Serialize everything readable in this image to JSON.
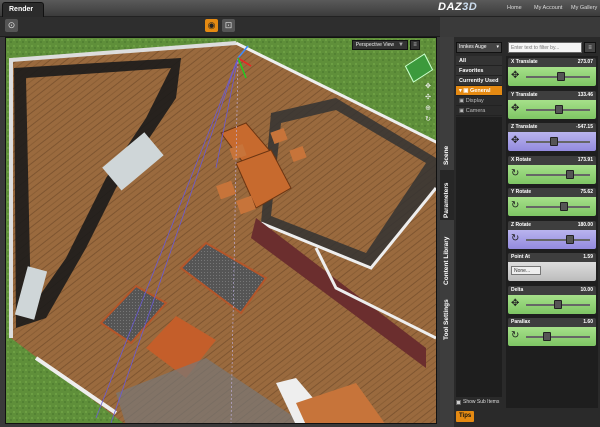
{
  "header": {
    "tab": "Render",
    "logo_text": "DAZ",
    "logo_3d": "3D",
    "links": [
      "Home",
      "My Account",
      "My Gallery"
    ]
  },
  "viewport": {
    "view_label": "Perspective View",
    "menu_arrow": "▼"
  },
  "side_tabs": [
    "Scene",
    "Parameters",
    "Content Library",
    "Tool Settings"
  ],
  "panel": {
    "node": "Innkes Auge",
    "filter_placeholder": "Enter text to filter by...",
    "tree": [
      {
        "label": "All",
        "style": "bold"
      },
      {
        "label": "Favorites",
        "style": "bold"
      },
      {
        "label": "Currently Used",
        "style": "bold"
      },
      {
        "label": "General",
        "style": "sel"
      },
      {
        "label": "Display",
        "style": "sub"
      },
      {
        "label": "Camera",
        "style": "sub"
      }
    ],
    "show_sub_items": "Show Sub Items",
    "tips": "Tips"
  },
  "params": [
    {
      "name": "X Translate",
      "value": "273.07",
      "color": "green",
      "icon": "move-icon",
      "level": 0.55
    },
    {
      "name": "Y Translate",
      "value": "133.46",
      "color": "green",
      "icon": "move-icon",
      "level": 0.52
    },
    {
      "name": "Z Translate",
      "value": "-547.15",
      "color": "purple",
      "icon": "move-icon",
      "level": 0.42
    },
    {
      "name": "X Rotate",
      "value": "173.91",
      "color": "green",
      "icon": "rotate-icon",
      "level": 0.72
    },
    {
      "name": "Y Rotate",
      "value": "75.62",
      "color": "green",
      "icon": "rotate-icon",
      "level": 0.6
    },
    {
      "name": "Z Rotate",
      "value": "180.00",
      "color": "purple",
      "icon": "rotate-icon",
      "level": 0.72
    },
    {
      "name": "Point At",
      "value": "1.59",
      "color": "gray",
      "icon": "button",
      "button_label": "None..."
    },
    {
      "name": "Delta",
      "value": "10.00",
      "color": "green",
      "icon": "move-icon",
      "level": 0.5
    },
    {
      "name": "Parallax",
      "value": "1.60",
      "color": "green",
      "icon": "rotate-icon",
      "level": 0.3
    }
  ]
}
